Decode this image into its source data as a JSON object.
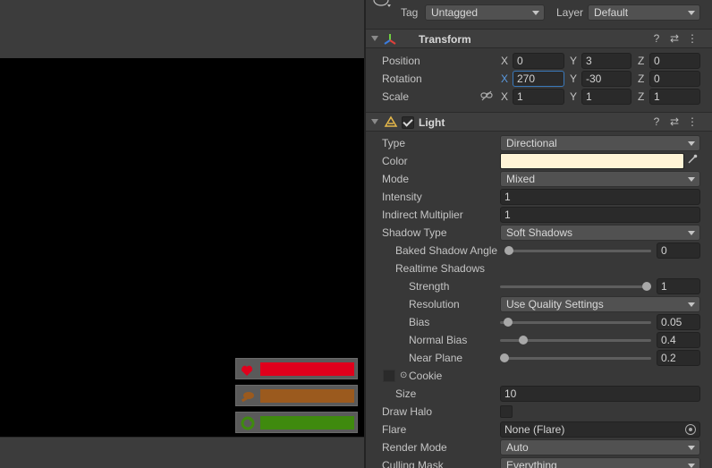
{
  "header": {
    "tag_label": "Tag",
    "tag_value": "Untagged",
    "layer_label": "Layer",
    "layer_value": "Default"
  },
  "transform": {
    "title": "Transform",
    "position": {
      "label": "Position",
      "x": "0",
      "y": "3",
      "z": "0"
    },
    "rotation": {
      "label": "Rotation",
      "x": "270",
      "y": "-30",
      "z": "0"
    },
    "scale": {
      "label": "Scale",
      "x": "1",
      "y": "1",
      "z": "1"
    },
    "axis": {
      "x": "X",
      "y": "Y",
      "z": "Z"
    }
  },
  "light": {
    "title": "Light",
    "enabled": true,
    "type": {
      "label": "Type",
      "value": "Directional"
    },
    "color": {
      "label": "Color",
      "value": "#fff4d6"
    },
    "mode": {
      "label": "Mode",
      "value": "Mixed"
    },
    "intensity": {
      "label": "Intensity",
      "value": "1"
    },
    "indirect": {
      "label": "Indirect Multiplier",
      "value": "1"
    },
    "shadow_type": {
      "label": "Shadow Type",
      "value": "Soft Shadows"
    },
    "baked_angle": {
      "label": "Baked Shadow Angle",
      "value": "0",
      "fraction": 0.0
    },
    "realtime_shadows": {
      "label": "Realtime Shadows"
    },
    "strength": {
      "label": "Strength",
      "value": "1",
      "fraction": 1.0
    },
    "resolution": {
      "label": "Resolution",
      "value": "Use Quality Settings"
    },
    "bias": {
      "label": "Bias",
      "value": "0.05",
      "fraction": 0.025
    },
    "normal_bias": {
      "label": "Normal Bias",
      "value": "0.4",
      "fraction": 0.133
    },
    "near_plane": {
      "label": "Near Plane",
      "value": "0.2",
      "fraction": 0.0
    },
    "cookie": {
      "label": "Cookie"
    },
    "size": {
      "label": "Size",
      "value": "10"
    },
    "draw_halo": {
      "label": "Draw Halo",
      "checked": false
    },
    "flare": {
      "label": "Flare",
      "value": "None (Flare)"
    },
    "render_mode": {
      "label": "Render Mode",
      "value": "Auto"
    },
    "culling_mask": {
      "label": "Culling Mask",
      "value": "Everything"
    }
  },
  "hud": [
    {
      "icon": "heart-hand-icon",
      "color": "#e0001c",
      "level": 1.0
    },
    {
      "icon": "food-icon",
      "color": "#9b5a1e",
      "level": 1.0
    },
    {
      "icon": "recycle-icon",
      "color": "#3f8a0e",
      "level": 1.0
    }
  ]
}
